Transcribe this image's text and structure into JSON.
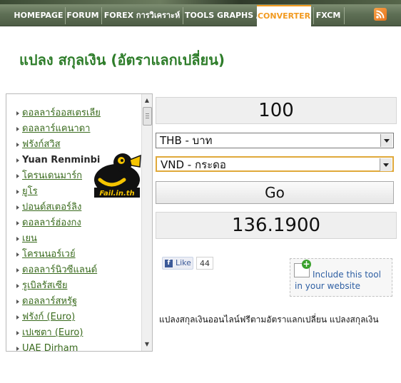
{
  "nav": {
    "items": [
      "HOMEPAGE",
      "FORUM",
      "FOREX การวิเคราะห์",
      "TOOLS GRAPHS /",
      "CONVERTER",
      "FXCM"
    ],
    "active": "CONVERTER",
    "active_color": "#f29a1f"
  },
  "page": {
    "title": "แปลง สกุลเงิน (อัตราแลกเปลี่ยน)",
    "title_color": "#2e7d2a"
  },
  "currency_list": {
    "items": [
      "ดอลลาร์ออสเตรเลีย",
      "ดอลลาร์แคนาดา",
      "ฟรังก์สวิส",
      "Yuan Renminbi",
      "โครนเดนมาร์ก",
      "ยูโร",
      "ปอนด์สเตอร์ลิง",
      "ดอลลาร์ฮ่องกง",
      "เยน",
      "โครนนอร์เวย์",
      "ดอลลาร์นิวซีแลนด์",
      "รูเบิลรัสเซีย",
      "ดอลลาร์สหรัฐ",
      "ฟรังก์ (Euro)",
      "เปเซตา (Euro)",
      "UAE Dirham"
    ],
    "link_color": "#3a6b1e"
  },
  "watermark": {
    "text": "Fail.in.th"
  },
  "converter": {
    "amount": "100",
    "from_currency": "THB - บาท",
    "to_currency": "VND - กระดอ",
    "go_label": "Go",
    "result": "136.1900"
  },
  "social": {
    "like_label": "Like",
    "like_count": "44"
  },
  "include_tool": {
    "label": "Include this tool in your website"
  },
  "description": "แปลงสกุลเงินออนไลน์ฟรีตามอัตราแลกเปลี่ยน แปลงสกุลเงิน"
}
